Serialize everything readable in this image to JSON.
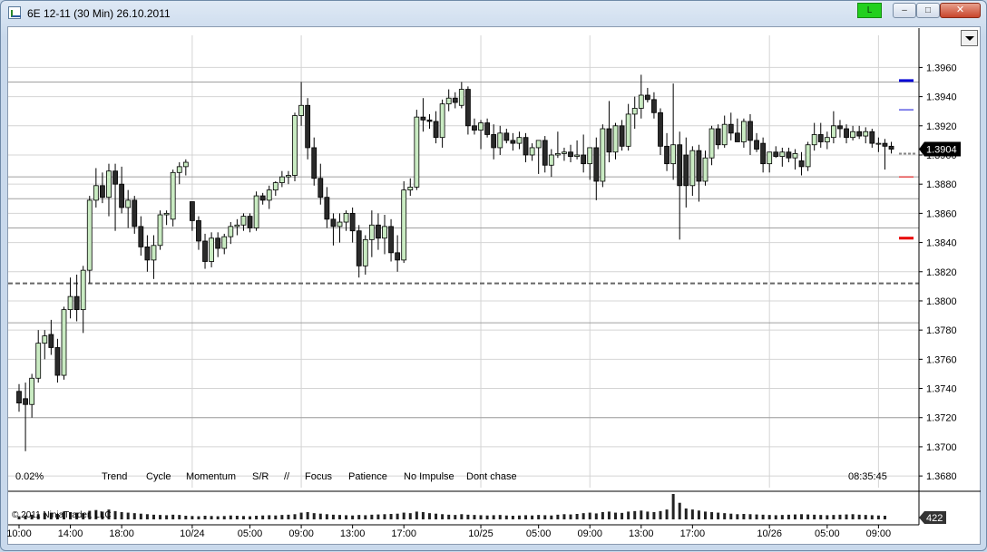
{
  "window": {
    "title": "6E 12-11 (30 Min)  26.10.2011",
    "live_button": "L",
    "min_symbol": "–",
    "max_symbol": "□",
    "close_symbol": "✕"
  },
  "icons": {
    "app": "chart-window-icon",
    "dropdown": "chevron-down-icon"
  },
  "overlay": {
    "percent": "0.02%",
    "clock": "08:35:45",
    "copyright": "© 2011 NinjaTrader, LLC"
  },
  "indicators": [
    "Trend",
    "Cycle",
    "Momentum",
    "S/R",
    "//",
    "Focus",
    "Patience",
    "No Impulse",
    "Dont chase"
  ],
  "colors": {
    "up_candle": "#c9ebc2",
    "down_candle": "#2a2a2a",
    "wick": "#000000",
    "gridline": "#d4d4d4",
    "level_line": "#a0a0a0",
    "dashed_level": "#666666",
    "marker_blue": "#0a0ad6",
    "marker_red": "#e80000",
    "last_price_bg": "#000000",
    "volume_bar": "#222222"
  },
  "chart_data": {
    "type": "candlestick",
    "instrument": "6E 12-11",
    "interval": "30 Min",
    "ylim": [
      1.3672,
      1.3982
    ],
    "y_ticks": [
      "1.3960",
      "1.3940",
      "1.3920",
      "1.3900",
      "1.3880",
      "1.3860",
      "1.3840",
      "1.3820",
      "1.3800",
      "1.3780",
      "1.3760",
      "1.3740",
      "1.3720",
      "1.3700",
      "1.3680"
    ],
    "x_ticks": [
      {
        "bar": 0,
        "label": "10:00"
      },
      {
        "bar": 8,
        "label": "14:00"
      },
      {
        "bar": 16,
        "label": "18:00"
      },
      {
        "bar": 27,
        "label": "10/24"
      },
      {
        "bar": 36,
        "label": "05:00"
      },
      {
        "bar": 44,
        "label": "09:00"
      },
      {
        "bar": 52,
        "label": "13:00"
      },
      {
        "bar": 60,
        "label": "17:00"
      },
      {
        "bar": 72,
        "label": "10/25"
      },
      {
        "bar": 81,
        "label": "05:00"
      },
      {
        "bar": 89,
        "label": "09:00"
      },
      {
        "bar": 97,
        "label": "13:00"
      },
      {
        "bar": 105,
        "label": "17:00"
      },
      {
        "bar": 117,
        "label": "10/26"
      },
      {
        "bar": 126,
        "label": "05:00"
      },
      {
        "bar": 134,
        "label": "09:00"
      }
    ],
    "major_gridline_bars": [
      27,
      72,
      117
    ],
    "last_price": "1.3904",
    "last_volume": "422",
    "horizontal_levels": [
      1.395,
      1.3885,
      1.387,
      1.385,
      1.3785,
      1.372
    ],
    "dashed_level": 1.3812,
    "right_markers": [
      {
        "price": 1.3951,
        "color": "blue",
        "thick": true
      },
      {
        "price": 1.3931,
        "color": "blue",
        "thick": false
      },
      {
        "price": 1.3885,
        "color": "red",
        "thick": false
      },
      {
        "price": 1.3843,
        "color": "red",
        "thick": true
      }
    ],
    "candles": [
      [
        1.3738,
        1.3743,
        1.3724,
        1.373
      ],
      [
        1.3733,
        1.3744,
        1.3697,
        1.3729
      ],
      [
        1.3729,
        1.375,
        1.372,
        1.3747
      ],
      [
        1.3747,
        1.378,
        1.3744,
        1.3771
      ],
      [
        1.3771,
        1.378,
        1.376,
        1.3776
      ],
      [
        1.3777,
        1.3787,
        1.3763,
        1.3768
      ],
      [
        1.3768,
        1.3774,
        1.3744,
        1.3749
      ],
      [
        1.3749,
        1.3796,
        1.3746,
        1.3794
      ],
      [
        1.3794,
        1.3816,
        1.3788,
        1.3803
      ],
      [
        1.3803,
        1.3818,
        1.3786,
        1.3794
      ],
      [
        1.3794,
        1.3824,
        1.3778,
        1.3821
      ],
      [
        1.3821,
        1.3872,
        1.3812,
        1.3869
      ],
      [
        1.3869,
        1.3891,
        1.3864,
        1.3879
      ],
      [
        1.3879,
        1.3888,
        1.3867,
        1.3871
      ],
      [
        1.3871,
        1.3894,
        1.3858,
        1.3889
      ],
      [
        1.3889,
        1.3894,
        1.3848,
        1.388
      ],
      [
        1.388,
        1.3892,
        1.386,
        1.3864
      ],
      [
        1.3864,
        1.3876,
        1.385,
        1.3869
      ],
      [
        1.3869,
        1.3872,
        1.3846,
        1.3851
      ],
      [
        1.3851,
        1.3858,
        1.3831,
        1.3837
      ],
      [
        1.3837,
        1.3845,
        1.382,
        1.3828
      ],
      [
        1.3828,
        1.3845,
        1.3815,
        1.3838
      ],
      [
        1.3838,
        1.3862,
        1.3835,
        1.3859
      ],
      [
        1.3859,
        1.3862,
        1.3852,
        1.386
      ],
      [
        1.3856,
        1.389,
        1.3851,
        1.3888
      ],
      [
        1.3888,
        1.3895,
        1.388,
        1.3892
      ],
      [
        1.3892,
        1.3897,
        1.3886,
        1.3895
      ],
      [
        1.3868,
        1.3868,
        1.3848,
        1.3855
      ],
      [
        1.3855,
        1.3858,
        1.3835,
        1.3841
      ],
      [
        1.3841,
        1.3846,
        1.3822,
        1.3827
      ],
      [
        1.3827,
        1.3847,
        1.3823,
        1.3843
      ],
      [
        1.3843,
        1.3847,
        1.383,
        1.3836
      ],
      [
        1.3836,
        1.3846,
        1.3832,
        1.3844
      ],
      [
        1.3844,
        1.3854,
        1.3839,
        1.3851
      ],
      [
        1.3851,
        1.3856,
        1.3845,
        1.3852
      ],
      [
        1.3852,
        1.386,
        1.3848,
        1.3858
      ],
      [
        1.3858,
        1.386,
        1.3847,
        1.385
      ],
      [
        1.385,
        1.3875,
        1.3848,
        1.3872
      ],
      [
        1.3872,
        1.3874,
        1.3866,
        1.3869
      ],
      [
        1.3869,
        1.3879,
        1.3863,
        1.3876
      ],
      [
        1.3876,
        1.3882,
        1.3872,
        1.3881
      ],
      [
        1.3881,
        1.3889,
        1.3878,
        1.3885
      ],
      [
        1.3885,
        1.3889,
        1.388,
        1.3886
      ],
      [
        1.3886,
        1.3929,
        1.3882,
        1.3927
      ],
      [
        1.3927,
        1.395,
        1.392,
        1.3934
      ],
      [
        1.3934,
        1.3939,
        1.3897,
        1.3905
      ],
      [
        1.3905,
        1.3912,
        1.3879,
        1.3884
      ],
      [
        1.3884,
        1.3894,
        1.3866,
        1.3871
      ],
      [
        1.3871,
        1.3878,
        1.385,
        1.3856
      ],
      [
        1.3856,
        1.386,
        1.3838,
        1.3851
      ],
      [
        1.3851,
        1.386,
        1.384,
        1.3854
      ],
      [
        1.3854,
        1.3862,
        1.3848,
        1.386
      ],
      [
        1.386,
        1.3864,
        1.384,
        1.3848
      ],
      [
        1.3848,
        1.3852,
        1.3816,
        1.3824
      ],
      [
        1.3824,
        1.3845,
        1.3818,
        1.3842
      ],
      [
        1.3842,
        1.3862,
        1.383,
        1.3852
      ],
      [
        1.3852,
        1.386,
        1.3835,
        1.3843
      ],
      [
        1.3843,
        1.3859,
        1.3832,
        1.3851
      ],
      [
        1.3851,
        1.3856,
        1.3827,
        1.3833
      ],
      [
        1.3833,
        1.3845,
        1.382,
        1.3828
      ],
      [
        1.3828,
        1.3882,
        1.3826,
        1.3876
      ],
      [
        1.3876,
        1.3884,
        1.3872,
        1.3878
      ],
      [
        1.3878,
        1.3931,
        1.3876,
        1.3926
      ],
      [
        1.3926,
        1.3939,
        1.3916,
        1.3924
      ],
      [
        1.3924,
        1.3928,
        1.3918,
        1.3923
      ],
      [
        1.3923,
        1.393,
        1.3908,
        1.3912
      ],
      [
        1.3912,
        1.3938,
        1.3905,
        1.3935
      ],
      [
        1.3935,
        1.3945,
        1.393,
        1.3939
      ],
      [
        1.3939,
        1.3943,
        1.3932,
        1.3936
      ],
      [
        1.3934,
        1.395,
        1.3932,
        1.3945
      ],
      [
        1.3945,
        1.3947,
        1.3914,
        1.392
      ],
      [
        1.392,
        1.3925,
        1.3914,
        1.3917
      ],
      [
        1.3917,
        1.3924,
        1.3904,
        1.3922
      ],
      [
        1.3922,
        1.3925,
        1.3912,
        1.3914
      ],
      [
        1.3914,
        1.3921,
        1.3897,
        1.3905
      ],
      [
        1.3905,
        1.392,
        1.39,
        1.3915
      ],
      [
        1.3915,
        1.3918,
        1.3908,
        1.391
      ],
      [
        1.391,
        1.3915,
        1.3903,
        1.3908
      ],
      [
        1.3908,
        1.3916,
        1.3904,
        1.3912
      ],
      [
        1.3912,
        1.3915,
        1.3895,
        1.39
      ],
      [
        1.39,
        1.3908,
        1.3896,
        1.3905
      ],
      [
        1.3905,
        1.391,
        1.3887,
        1.391
      ],
      [
        1.391,
        1.3913,
        1.3888,
        1.3893
      ],
      [
        1.3893,
        1.3904,
        1.3885,
        1.39
      ],
      [
        1.39,
        1.3916,
        1.3898,
        1.3901
      ],
      [
        1.3901,
        1.3905,
        1.3896,
        1.3902
      ],
      [
        1.3902,
        1.3907,
        1.3895,
        1.3899
      ],
      [
        1.3899,
        1.391,
        1.3897,
        1.39
      ],
      [
        1.39,
        1.3914,
        1.3888,
        1.3894
      ],
      [
        1.3894,
        1.3898,
        1.3883,
        1.3905
      ],
      [
        1.3905,
        1.3912,
        1.3869,
        1.3882
      ],
      [
        1.3882,
        1.3921,
        1.3878,
        1.3918
      ],
      [
        1.3918,
        1.3937,
        1.3895,
        1.3902
      ],
      [
        1.3902,
        1.3922,
        1.3897,
        1.392
      ],
      [
        1.392,
        1.3924,
        1.3903,
        1.3906
      ],
      [
        1.3906,
        1.3935,
        1.3903,
        1.3928
      ],
      [
        1.3928,
        1.394,
        1.3918,
        1.3932
      ],
      [
        1.3932,
        1.3955,
        1.3925,
        1.3941
      ],
      [
        1.3941,
        1.3946,
        1.3936,
        1.3938
      ],
      [
        1.3938,
        1.3943,
        1.3925,
        1.3929
      ],
      [
        1.3929,
        1.3932,
        1.39,
        1.3906
      ],
      [
        1.3906,
        1.3915,
        1.3889,
        1.3894
      ],
      [
        1.3894,
        1.3949,
        1.3883,
        1.3907
      ],
      [
        1.3907,
        1.3916,
        1.3842,
        1.3879
      ],
      [
        1.39,
        1.3912,
        1.3864,
        1.3879
      ],
      [
        1.3879,
        1.3906,
        1.3872,
        1.3903
      ],
      [
        1.3903,
        1.3907,
        1.3868,
        1.3882
      ],
      [
        1.3882,
        1.3903,
        1.3879,
        1.3898
      ],
      [
        1.3898,
        1.392,
        1.3893,
        1.3918
      ],
      [
        1.3918,
        1.3921,
        1.3904,
        1.3907
      ],
      [
        1.3907,
        1.3927,
        1.3905,
        1.3921
      ],
      [
        1.3921,
        1.3929,
        1.391,
        1.3915
      ],
      [
        1.3915,
        1.3925,
        1.3909,
        1.3909
      ],
      [
        1.3909,
        1.3925,
        1.3905,
        1.3923
      ],
      [
        1.3923,
        1.3928,
        1.39,
        1.391
      ],
      [
        1.391,
        1.3915,
        1.3902,
        1.3904
      ],
      [
        1.3908,
        1.3912,
        1.3888,
        1.3894
      ],
      [
        1.3894,
        1.3902,
        1.3888,
        1.3902
      ],
      [
        1.3902,
        1.3906,
        1.3898,
        1.3899
      ],
      [
        1.3899,
        1.3905,
        1.3892,
        1.3902
      ],
      [
        1.3902,
        1.3905,
        1.3895,
        1.3898
      ],
      [
        1.3898,
        1.3904,
        1.389,
        1.3901
      ],
      [
        1.3896,
        1.3902,
        1.3886,
        1.3892
      ],
      [
        1.3892,
        1.3909,
        1.3889,
        1.3907
      ],
      [
        1.3907,
        1.3922,
        1.3903,
        1.3914
      ],
      [
        1.3914,
        1.3922,
        1.3905,
        1.3909
      ],
      [
        1.3909,
        1.3916,
        1.3904,
        1.3912
      ],
      [
        1.3912,
        1.393,
        1.3908,
        1.392
      ],
      [
        1.392,
        1.3924,
        1.3912,
        1.3918
      ],
      [
        1.3918,
        1.3921,
        1.3908,
        1.3912
      ],
      [
        1.3912,
        1.392,
        1.391,
        1.3916
      ],
      [
        1.3916,
        1.392,
        1.3911,
        1.3913
      ],
      [
        1.3913,
        1.3919,
        1.3908,
        1.3916
      ],
      [
        1.3916,
        1.3918,
        1.3905,
        1.3908
      ],
      [
        1.3908,
        1.3912,
        1.3902,
        1.3908
      ],
      [
        1.3908,
        1.3911,
        1.389,
        1.3906
      ],
      [
        1.3906,
        1.3909,
        1.3901,
        1.3904
      ]
    ],
    "volumes": [
      120,
      150,
      180,
      200,
      240,
      260,
      210,
      300,
      280,
      260,
      240,
      330,
      360,
      300,
      380,
      320,
      280,
      260,
      240,
      220,
      200,
      180,
      170,
      160,
      180,
      170,
      140,
      130,
      120,
      140,
      130,
      120,
      130,
      150,
      140,
      130,
      120,
      140,
      150,
      160,
      150,
      170,
      180,
      200,
      260,
      280,
      240,
      220,
      200,
      180,
      170,
      160,
      150,
      170,
      160,
      180,
      190,
      200,
      210,
      220,
      260,
      240,
      300,
      280,
      240,
      220,
      200,
      180,
      170,
      200,
      180,
      170,
      160,
      150,
      160,
      170,
      150,
      140,
      150,
      160,
      150,
      170,
      160,
      150,
      180,
      200,
      190,
      210,
      240,
      260,
      230,
      280,
      300,
      260,
      250,
      300,
      320,
      340,
      300,
      280,
      320,
      380,
      980,
      640,
      420,
      380,
      340,
      300,
      280,
      260,
      240,
      220,
      200,
      210,
      200,
      190,
      180,
      170,
      160,
      170,
      180,
      190,
      200,
      190,
      180,
      170,
      160,
      170,
      180,
      190,
      200,
      180,
      170,
      160,
      150,
      140
    ]
  }
}
